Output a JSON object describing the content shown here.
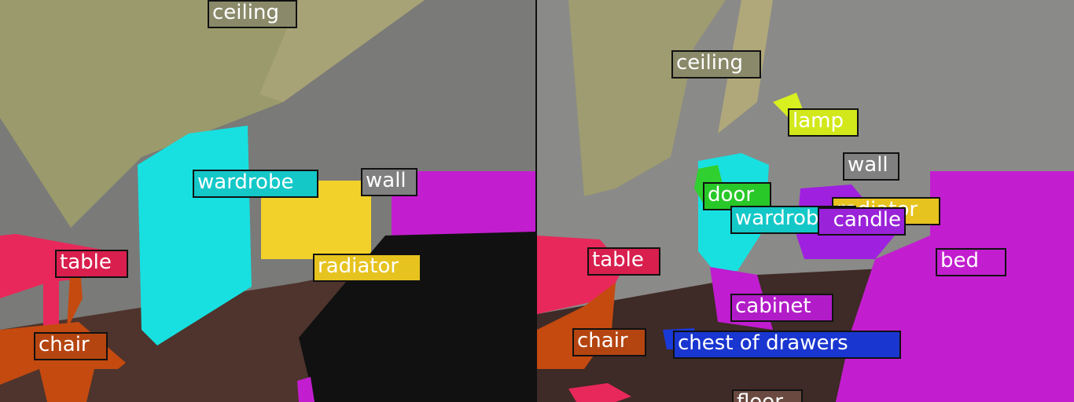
{
  "colors": {
    "ceiling": "#9a9a6a",
    "wall": "#7a7a7a",
    "wardrobe": "#18e0e0",
    "radiator": "#f2d22a",
    "table": "#e8285a",
    "chair": "#c44a10",
    "bed": "#c21ecf",
    "lamp": "#d8f020",
    "door": "#30d030",
    "candle": "#a020e0",
    "cabinet": "#c01cd0",
    "chest_of_drawers": "#1a3ad8",
    "floor": "#5a3a34"
  },
  "left_panel": {
    "labels": [
      {
        "id": "ceiling",
        "text": "ceiling",
        "color": "#8a8a6a"
      },
      {
        "id": "wardrobe",
        "text": "wardrobe",
        "color": "#14c8c8"
      },
      {
        "id": "wall",
        "text": "wall",
        "color": "#808080"
      },
      {
        "id": "table",
        "text": "table",
        "color": "#d81f4e"
      },
      {
        "id": "radiator",
        "text": "radiator",
        "color": "#e6c31f"
      },
      {
        "id": "chair",
        "text": "chair",
        "color": "#b54510"
      }
    ]
  },
  "right_panel": {
    "labels": [
      {
        "id": "ceiling",
        "text": "ceiling",
        "color": "#8a8a6a"
      },
      {
        "id": "lamp",
        "text": "lamp",
        "color": "#d2e81a"
      },
      {
        "id": "wall",
        "text": "wall",
        "color": "#808080"
      },
      {
        "id": "door",
        "text": "door",
        "color": "#28c828"
      },
      {
        "id": "radiator",
        "text": "radiator",
        "color": "#e6c31f"
      },
      {
        "id": "wardrobe",
        "text": "wardrobe",
        "color": "#14c8c8"
      },
      {
        "id": "candle",
        "text": "candle",
        "color": "#9a22d8"
      },
      {
        "id": "table",
        "text": "table",
        "color": "#d81f4e"
      },
      {
        "id": "bed",
        "text": "bed",
        "color": "#c21ecf"
      },
      {
        "id": "cabinet",
        "text": "cabinet",
        "color": "#b21cc8"
      },
      {
        "id": "chair",
        "text": "chair",
        "color": "#b54510"
      },
      {
        "id": "chest_of_drawers",
        "text": "chest of drawers",
        "color": "#1a36d0"
      },
      {
        "id": "floor",
        "text": "floor",
        "color": "#6a4a40"
      }
    ]
  }
}
